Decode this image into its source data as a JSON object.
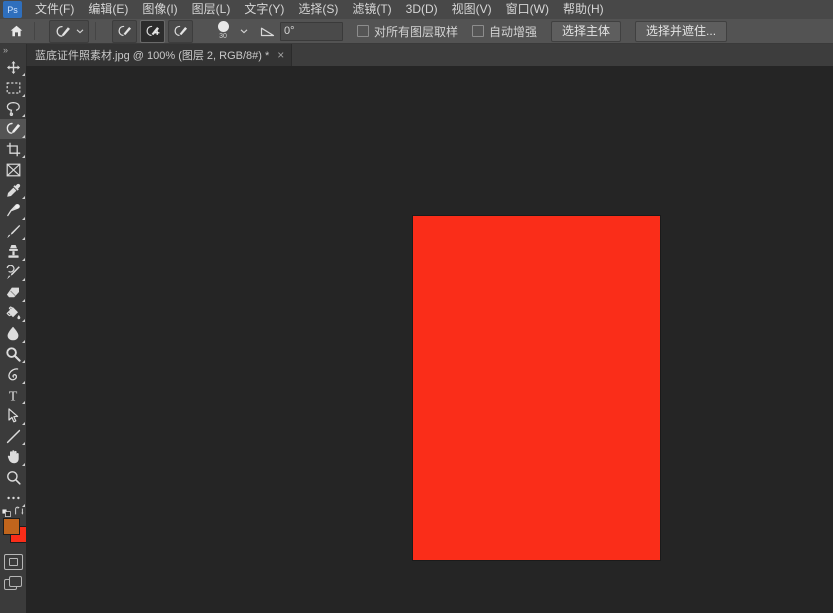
{
  "app": {
    "name": "Adobe Photoshop",
    "logo_text": "Ps"
  },
  "menubar": {
    "items": [
      {
        "label": "文件(F)",
        "name": "menu-file"
      },
      {
        "label": "编辑(E)",
        "name": "menu-edit"
      },
      {
        "label": "图像(I)",
        "name": "menu-image"
      },
      {
        "label": "图层(L)",
        "name": "menu-layer"
      },
      {
        "label": "文字(Y)",
        "name": "menu-type"
      },
      {
        "label": "选择(S)",
        "name": "menu-select"
      },
      {
        "label": "滤镜(T)",
        "name": "menu-filter"
      },
      {
        "label": "3D(D)",
        "name": "menu-3d"
      },
      {
        "label": "视图(V)",
        "name": "menu-view"
      },
      {
        "label": "窗口(W)",
        "name": "menu-window"
      },
      {
        "label": "帮助(H)",
        "name": "menu-help"
      }
    ]
  },
  "options_bar": {
    "home_icon": "home-icon",
    "tool_preset_icon": "quick-selection-icon",
    "preset_chevron": "chevron-down-icon",
    "selection_modes": [
      {
        "name": "selection-mode-new",
        "icon": "quick-selection-new-icon",
        "active": false
      },
      {
        "name": "selection-mode-add",
        "icon": "quick-selection-add-icon",
        "active": true
      },
      {
        "name": "selection-mode-subtract",
        "icon": "quick-selection-subtract-icon",
        "active": false
      }
    ],
    "brush_size": "30",
    "brush_chevron": "chevron-down-icon",
    "angle_icon": "angle-icon",
    "angle_value": "0°",
    "checkboxes": [
      {
        "label": "对所有图层取样",
        "checked": false,
        "name": "sample-all-layers-checkbox"
      },
      {
        "label": "自动增强",
        "checked": false,
        "name": "auto-enhance-checkbox"
      }
    ],
    "buttons": [
      {
        "label": "选择主体",
        "name": "select-subject-button"
      },
      {
        "label": "选择并遮住...",
        "name": "select-and-mask-button"
      }
    ]
  },
  "tabs": [
    {
      "label": "蓝底证件照素材.jpg @ 100% (图层 2, RGB/8#) *",
      "close": "×",
      "name": "document-tab"
    }
  ],
  "toolbar": {
    "collapse_glyph": "»",
    "tools": [
      {
        "label": "移动工具",
        "icon": "move-icon",
        "active": false,
        "has_more": true
      },
      {
        "label": "矩形选框工具",
        "icon": "rectangular-marquee-icon",
        "active": false,
        "has_more": true
      },
      {
        "label": "套索工具",
        "icon": "lasso-icon",
        "active": false,
        "has_more": true
      },
      {
        "label": "快速选择工具",
        "icon": "quick-selection-icon",
        "active": true,
        "has_more": true
      },
      {
        "label": "裁剪工具",
        "icon": "crop-icon",
        "active": false,
        "has_more": true
      },
      {
        "label": "画框工具",
        "icon": "frame-icon",
        "active": false,
        "has_more": false
      },
      {
        "label": "吸管工具",
        "icon": "eyedropper-icon",
        "active": false,
        "has_more": true
      },
      {
        "label": "污点修复画笔工具",
        "icon": "healing-brush-icon",
        "active": false,
        "has_more": true
      },
      {
        "label": "画笔工具",
        "icon": "brush-icon",
        "active": false,
        "has_more": true
      },
      {
        "label": "仿制图章工具",
        "icon": "clone-stamp-icon",
        "active": false,
        "has_more": true
      },
      {
        "label": "历史记录画笔工具",
        "icon": "history-brush-icon",
        "active": false,
        "has_more": true
      },
      {
        "label": "橡皮擦工具",
        "icon": "eraser-icon",
        "active": false,
        "has_more": true
      },
      {
        "label": "渐变工具",
        "icon": "paint-bucket-icon",
        "active": false,
        "has_more": true
      },
      {
        "label": "模糊工具",
        "icon": "blur-droplet-icon",
        "active": false,
        "has_more": true
      },
      {
        "label": "减淡工具",
        "icon": "dodge-icon",
        "active": false,
        "has_more": true
      },
      {
        "label": "钢笔工具",
        "icon": "pen-icon",
        "active": false,
        "has_more": true
      },
      {
        "label": "横排文字工具",
        "icon": "type-icon",
        "active": false,
        "has_more": true
      },
      {
        "label": "路径选择工具",
        "icon": "path-selection-icon",
        "active": false,
        "has_more": true
      },
      {
        "label": "直线工具",
        "icon": "line-shape-icon",
        "active": false,
        "has_more": true
      },
      {
        "label": "抓手工具",
        "icon": "hand-icon",
        "active": false,
        "has_more": true
      },
      {
        "label": "缩放工具",
        "icon": "zoom-icon",
        "active": false,
        "has_more": false
      },
      {
        "label": "编辑工具栏",
        "icon": "more-tools-ellipsis-icon",
        "active": false,
        "has_more": true
      }
    ],
    "colors": {
      "foreground": "#c1651c",
      "background": "#fa2d19",
      "default_icon": "default-colors-icon",
      "swap_icon": "swap-colors-icon"
    },
    "bottom": [
      {
        "label": "以快速蒙版模式编辑",
        "icon": "quick-mask-icon"
      },
      {
        "label": "更改屏幕模式",
        "icon": "screen-mode-icon"
      }
    ]
  },
  "canvas": {
    "background_color": "#252525",
    "document": {
      "name": "document-image",
      "fill_color": "#fa2d19",
      "zoom": "100%"
    }
  }
}
